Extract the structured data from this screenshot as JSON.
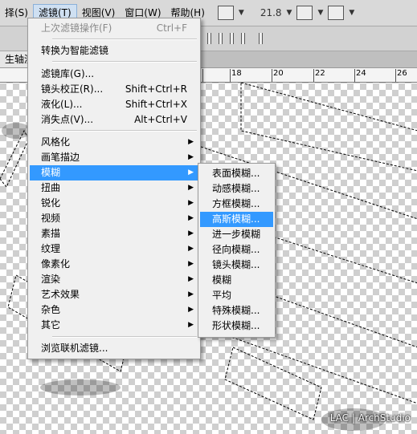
{
  "menubar": {
    "items": [
      "择(S)",
      "滤镜(T)",
      "视图(V)",
      "窗口(W)",
      "帮助(H)"
    ],
    "zoom": "21.8"
  },
  "tab": {
    "label": "生轴测…"
  },
  "ruler": {
    "labels": [
      "18",
      "20",
      "22",
      "24",
      "26"
    ]
  },
  "filter_menu": {
    "last_filter": "上次滤镜操作(F)",
    "last_filter_shortcut": "Ctrl+F",
    "smart": "转换为智能滤镜",
    "gallery": "滤镜库(G)...",
    "lens": "镜头校正(R)...",
    "lens_shortcut": "Shift+Ctrl+R",
    "liquify": "液化(L)...",
    "liquify_shortcut": "Shift+Ctrl+X",
    "vanish": "消失点(V)...",
    "vanish_shortcut": "Alt+Ctrl+V",
    "categories": [
      "风格化",
      "画笔描边",
      "模糊",
      "扭曲",
      "锐化",
      "视频",
      "素描",
      "纹理",
      "像素化",
      "渲染",
      "艺术效果",
      "杂色",
      "其它"
    ],
    "browse": "浏览联机滤镜..."
  },
  "blur_submenu": {
    "items": [
      "表面模糊...",
      "动感模糊...",
      "方框模糊...",
      "高斯模糊...",
      "进一步模糊",
      "径向模糊...",
      "镜头模糊...",
      "模糊",
      "平均",
      "特殊模糊...",
      "形状模糊..."
    ],
    "highlighted": "高斯模糊..."
  },
  "watermark": "LAC | ArchStudio",
  "colors": {
    "highlight": "#3399ff",
    "menu_bg": "#f0f0f0"
  }
}
